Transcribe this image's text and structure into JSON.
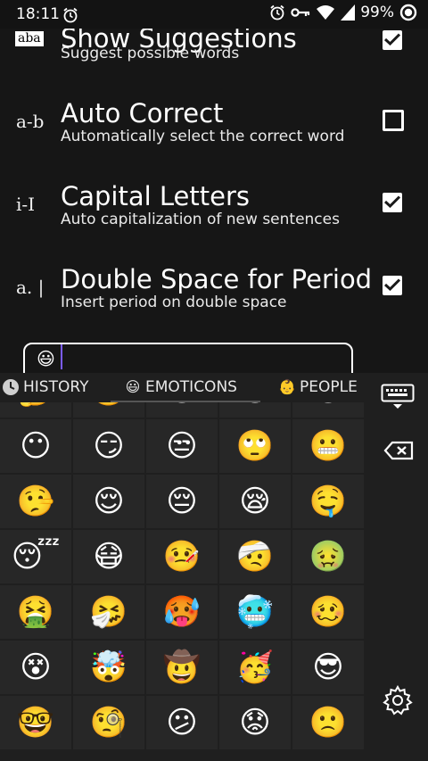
{
  "status_bar": {
    "time": "18:11",
    "battery": "99%"
  },
  "settings": {
    "partial_title": "Show Suggestions",
    "aba_icon": "aba",
    "rows": [
      {
        "icon": "",
        "title": "",
        "subtitle": "Suggest possible words",
        "checked": true
      },
      {
        "icon": "a-b",
        "title": "Auto Correct",
        "subtitle": "Automatically select the correct word",
        "checked": false
      },
      {
        "icon": "i-I",
        "title": "Capital Letters",
        "subtitle": "Auto capitalization of new sentences",
        "checked": true
      },
      {
        "icon": "a. |",
        "title": "Double Space for Period",
        "subtitle": "Insert period on double space",
        "checked": true
      }
    ],
    "input_value": "😃"
  },
  "keyboard": {
    "tabs": [
      {
        "label": "HISTORY",
        "icon": "clock-icon"
      },
      {
        "label": "EMOTICONS",
        "icon": "😃"
      },
      {
        "label": "PEOPLE",
        "icon": "👶"
      }
    ],
    "emoji_rows": [
      [
        "🤔",
        "🤐",
        "😐",
        "😑",
        "😑"
      ],
      [
        "😶",
        "😏",
        "😒",
        "🙄",
        "😬"
      ],
      [
        "🤥",
        "😌",
        "😔",
        "😪",
        "🤤"
      ],
      [
        "😴",
        "😷",
        "🤒",
        "🤕",
        "🤢"
      ],
      [
        "🤮",
        "🤧",
        "🥵",
        "🥶",
        "🥴"
      ],
      [
        "😵",
        "🤯",
        "🤠",
        "🥳",
        "😎"
      ],
      [
        "🤓",
        "🧐",
        "😕",
        "😟",
        "🙁"
      ]
    ]
  }
}
